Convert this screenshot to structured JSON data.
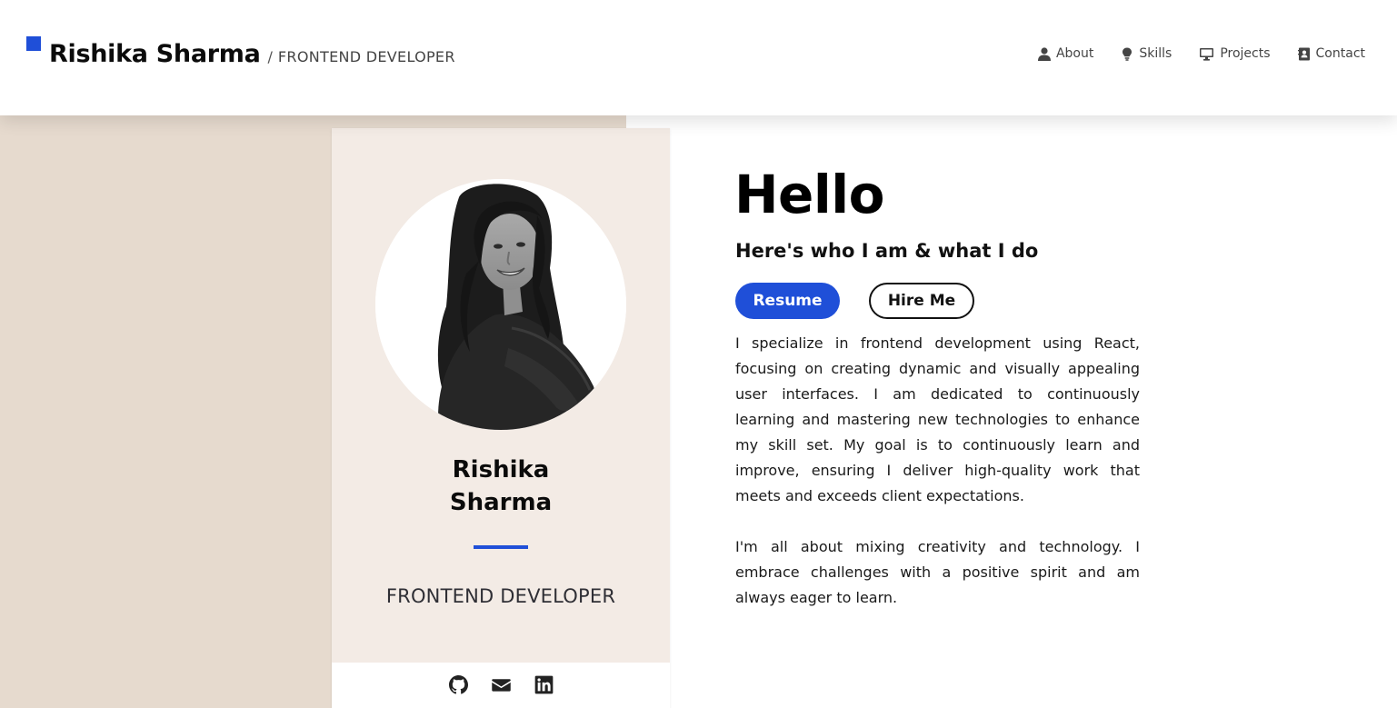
{
  "brand": {
    "name": "Rishika Sharma",
    "separator": "/",
    "role": "FRONTEND DEVELOPER",
    "accent_color": "#1f4fd8"
  },
  "nav": {
    "items": [
      {
        "label": "About",
        "icon": "user-icon"
      },
      {
        "label": "Skills",
        "icon": "lightbulb-icon"
      },
      {
        "label": "Projects",
        "icon": "monitor-icon"
      },
      {
        "label": "Contact",
        "icon": "address-book-icon"
      }
    ]
  },
  "profile_card": {
    "photo_icon": "profile-photo",
    "name_line1": "Rishika",
    "name_line2": "Sharma",
    "role": "FRONTEND DEVELOPER",
    "social": [
      {
        "icon": "github-icon"
      },
      {
        "icon": "envelope-icon"
      },
      {
        "icon": "linkedin-icon"
      }
    ]
  },
  "intro": {
    "greeting": "Hello",
    "subtitle": "Here's who I am & what I do",
    "resume_button": "Resume",
    "hire_button": "Hire Me",
    "paragraphs": [
      "I specialize in frontend development using React, focusing on creating dynamic and visually appealing user interfaces. I am dedicated to continuously learning and mastering new technologies to enhance my skill set. My goal is to continuously learn and improve, ensuring I deliver high-quality work that meets and exceeds client expectations.",
      "I'm all about mixing creativity and technology. I embrace challenges with a positive spirit and am always eager to learn."
    ]
  },
  "colors": {
    "left_background": "#e6dace",
    "card_background": "#f3ebe5",
    "primary": "#1f4fd8"
  }
}
